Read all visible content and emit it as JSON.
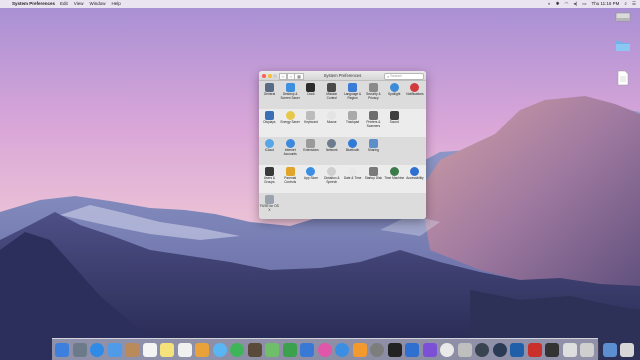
{
  "menubar": {
    "app_name": "System Preferences",
    "items": [
      "Edit",
      "View",
      "Window",
      "Help"
    ],
    "clock": "Thu 11:16 PM"
  },
  "desktop_icons": [
    {
      "label": "",
      "icon": "hard-drive-icon"
    },
    {
      "label": "",
      "icon": "folder-icon"
    },
    {
      "label": "",
      "icon": "document-icon"
    }
  ],
  "window": {
    "title": "System Preferences",
    "search_placeholder": "Search",
    "rows": [
      [
        {
          "label": "General",
          "icon": "general-icon",
          "color": "#5a6b86"
        },
        {
          "label": "Desktop & Screen Saver",
          "icon": "desktop-icon",
          "color": "#3d8fe0"
        },
        {
          "label": "Dock",
          "icon": "dock-icon",
          "color": "#2c2c2c"
        },
        {
          "label": "Mission Control",
          "icon": "mission-control-icon",
          "color": "#4a4a4a"
        },
        {
          "label": "Language & Region",
          "icon": "flag-icon",
          "color": "#3a7bd5"
        },
        {
          "label": "Security & Privacy",
          "icon": "house-icon",
          "color": "#8a8a8a"
        },
        {
          "label": "Spotlight",
          "icon": "spotlight-icon",
          "color": "#3b8bd9"
        },
        {
          "label": "Notifications",
          "icon": "notifications-icon",
          "color": "#d23b3b"
        }
      ],
      [
        {
          "label": "Displays",
          "icon": "display-icon",
          "color": "#3a6fb8"
        },
        {
          "label": "Energy Saver",
          "icon": "bulb-icon",
          "color": "#e6c84b"
        },
        {
          "label": "Keyboard",
          "icon": "keyboard-icon",
          "color": "#bcbcbc"
        },
        {
          "label": "Mouse",
          "icon": "mouse-icon",
          "color": "#e4e4e4"
        },
        {
          "label": "Trackpad",
          "icon": "trackpad-icon",
          "color": "#a9a9a9"
        },
        {
          "label": "Printers & Scanners",
          "icon": "printer-icon",
          "color": "#6e6e6e"
        },
        {
          "label": "Sound",
          "icon": "speaker-icon",
          "color": "#3f3f3f"
        }
      ],
      [
        {
          "label": "iCloud",
          "icon": "cloud-icon",
          "color": "#58a6e8"
        },
        {
          "label": "Internet Accounts",
          "icon": "at-icon",
          "color": "#3d89dc"
        },
        {
          "label": "Extensions",
          "icon": "puzzle-icon",
          "color": "#9a9a9a"
        },
        {
          "label": "Network",
          "icon": "globe-icon",
          "color": "#6c7c8e"
        },
        {
          "label": "Bluetooth",
          "icon": "bluetooth-icon",
          "color": "#2f7ad6"
        },
        {
          "label": "Sharing",
          "icon": "sharing-icon",
          "color": "#5c8fc9"
        }
      ],
      [
        {
          "label": "Users & Groups",
          "icon": "users-icon",
          "color": "#3a3a3a"
        },
        {
          "label": "Parental Controls",
          "icon": "parental-icon",
          "color": "#e2a52b"
        },
        {
          "label": "App Store",
          "icon": "appstore-icon",
          "color": "#3b8fe3"
        },
        {
          "label": "Dictation & Speech",
          "icon": "microphone-icon",
          "color": "#cfcfcf"
        },
        {
          "label": "Date & Time",
          "icon": "clock-icon",
          "color": "#e8e8e8"
        },
        {
          "label": "Startup Disk",
          "icon": "disk-icon",
          "color": "#7a7a7a"
        },
        {
          "label": "Time Machine",
          "icon": "time-machine-icon",
          "color": "#3c7a4a"
        },
        {
          "label": "Accessibility",
          "icon": "accessibility-icon",
          "color": "#2f6fd0"
        }
      ],
      [
        {
          "label": "FUSE for OS X",
          "icon": "fuse-icon",
          "color": "#9aa3ad"
        }
      ]
    ]
  },
  "dock": [
    {
      "name": "finder",
      "color": "#3d7fdc"
    },
    {
      "name": "launchpad",
      "color": "#6c7a8a"
    },
    {
      "name": "safari",
      "color": "#2f8be6"
    },
    {
      "name": "mail",
      "color": "#4f9be8"
    },
    {
      "name": "contacts",
      "color": "#b98b5a"
    },
    {
      "name": "calendar",
      "color": "#f4f4f4"
    },
    {
      "name": "notes",
      "color": "#f6e27a"
    },
    {
      "name": "reminders",
      "color": "#f0f0f0"
    },
    {
      "name": "photos",
      "color": "#e9a23a"
    },
    {
      "name": "messages",
      "color": "#59b6f2"
    },
    {
      "name": "facetime",
      "color": "#3fb55a"
    },
    {
      "name": "photo-booth",
      "color": "#5a4a3a"
    },
    {
      "name": "maps",
      "color": "#6fbf6a"
    },
    {
      "name": "numbers",
      "color": "#3ca14c"
    },
    {
      "name": "keynote",
      "color": "#3a78d6"
    },
    {
      "name": "itunes",
      "color": "#e056a8"
    },
    {
      "name": "app-store",
      "color": "#3a8fe3"
    },
    {
      "name": "ibooks",
      "color": "#f29a2e"
    },
    {
      "name": "system-preferences",
      "color": "#7d7d7d"
    },
    {
      "name": "terminal",
      "color": "#222222"
    },
    {
      "name": "xcode",
      "color": "#2f6fd0"
    },
    {
      "name": "imovie",
      "color": "#7b4fd6"
    },
    {
      "name": "chrome",
      "color": "#e9e9e9"
    },
    {
      "name": "textwrangler",
      "color": "#bfbfbf"
    },
    {
      "name": "dashboard",
      "color": "#38444f"
    },
    {
      "name": "steam",
      "color": "#2b3b55"
    },
    {
      "name": "virtualbox",
      "color": "#1f5ea8"
    },
    {
      "name": "filezilla",
      "color": "#c9302c"
    },
    {
      "name": "console",
      "color": "#333333"
    },
    {
      "name": "activity-monitor",
      "color": "#dedede"
    },
    {
      "name": "window-thumb",
      "color": "#cfcfcf"
    },
    {
      "name": "downloads",
      "color": "#5b8fd0"
    },
    {
      "name": "trash",
      "color": "#d7d7d7"
    }
  ]
}
